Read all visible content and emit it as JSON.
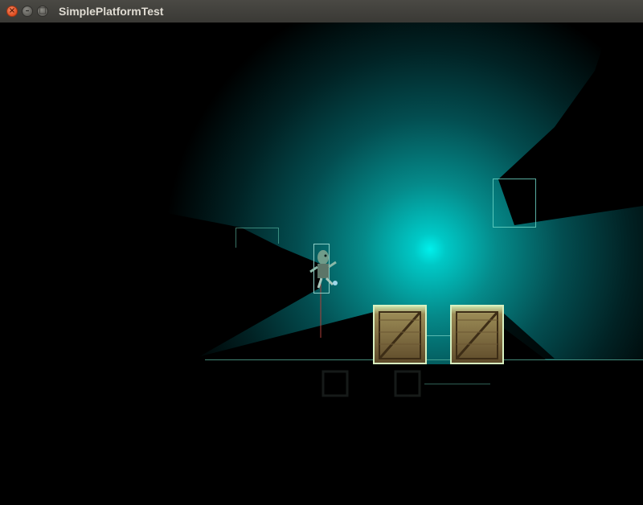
{
  "window": {
    "title": "SimplePlatformTest",
    "buttons": [
      {
        "name": "close",
        "icon": "close-icon"
      },
      {
        "name": "minimize",
        "icon": "minimize-icon"
      },
      {
        "name": "maximize",
        "icon": "maximize-icon"
      }
    ]
  },
  "scene": {
    "light_color": "#00e6e6",
    "debug_outline_color": "#6fd8c8",
    "floor_color": "#5fbfa8",
    "crate_color": "#b08a4e",
    "objects": [
      "player",
      "crate",
      "crate",
      "platform-outline",
      "platform-outline",
      "floor-line"
    ]
  }
}
